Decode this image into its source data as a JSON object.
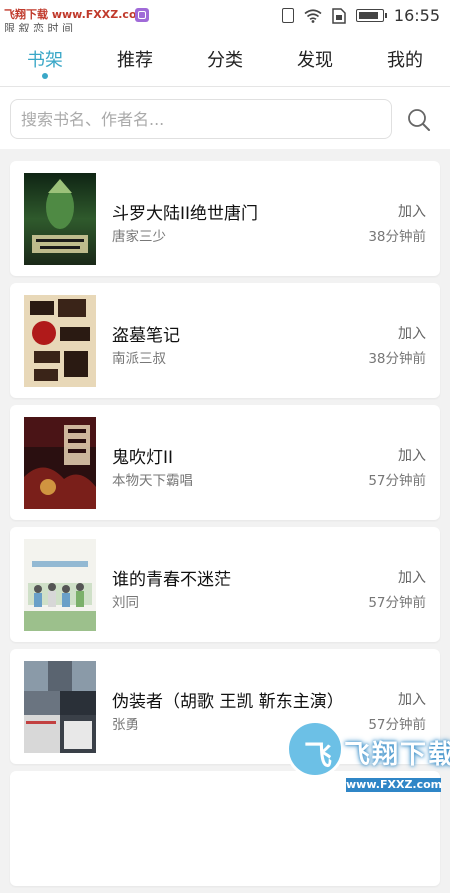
{
  "status_bar": {
    "watermark_line1": "飞翔下载 www.FXXZ.com",
    "watermark_line2": "限 叙 恋 时 间",
    "time": "16:55"
  },
  "tabs": [
    {
      "label": "书架",
      "active": true
    },
    {
      "label": "推荐",
      "active": false
    },
    {
      "label": "分类",
      "active": false
    },
    {
      "label": "发现",
      "active": false
    },
    {
      "label": "我的",
      "active": false
    }
  ],
  "search": {
    "placeholder": "搜索书名、作者名..."
  },
  "books": [
    {
      "title": "斗罗大陆II绝世唐门",
      "author": "唐家三少",
      "action": "加入",
      "time": "38分钟前",
      "cover_colors": [
        "#1c3a22",
        "#3f7a3a",
        "#d9d2a0"
      ]
    },
    {
      "title": "盗墓笔记",
      "author": "南派三叔",
      "action": "加入",
      "time": "38分钟前",
      "cover_colors": [
        "#e8d8b8",
        "#b01a1a",
        "#2a1a12"
      ]
    },
    {
      "title": "鬼吹灯II",
      "author": "本物天下霸唱",
      "action": "加入",
      "time": "57分钟前",
      "cover_colors": [
        "#2a0f10",
        "#7a1f1a",
        "#e6b24a"
      ]
    },
    {
      "title": "谁的青春不迷茫",
      "author": "刘同",
      "action": "加入",
      "time": "57分钟前",
      "cover_colors": [
        "#f3f3ee",
        "#6aa0c8",
        "#7bb06a"
      ]
    },
    {
      "title": "伪装者（胡歌 王凯 靳东主演）",
      "author": "张勇",
      "action": "加入",
      "time": "57分钟前",
      "cover_colors": [
        "#3a4048",
        "#8a9aa8",
        "#c24040"
      ]
    }
  ],
  "watermark": {
    "brand": "飞翔下载",
    "url": "www.FXXZ.com"
  },
  "accent_color": "#3aa7c7"
}
